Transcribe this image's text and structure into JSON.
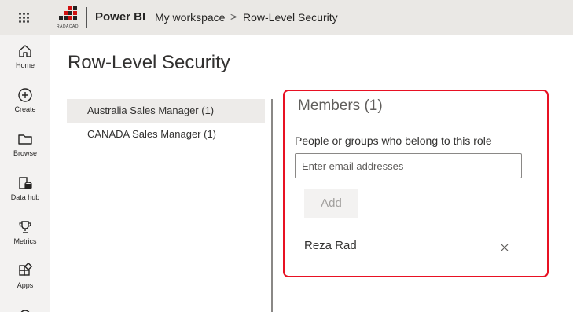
{
  "header": {
    "app_name": "Power BI",
    "breadcrumbs": [
      "My workspace",
      "Row-Level Security"
    ],
    "separator": ">",
    "logo_text": "RADACAD",
    "logo_icon": "radacad-logo"
  },
  "nav": {
    "items": [
      {
        "label": "Home",
        "icon": "home-icon"
      },
      {
        "label": "Create",
        "icon": "plus-circle-icon"
      },
      {
        "label": "Browse",
        "icon": "folder-icon"
      },
      {
        "label": "Data hub",
        "icon": "data-hub-icon"
      },
      {
        "label": "Metrics",
        "icon": "trophy-icon"
      },
      {
        "label": "Apps",
        "icon": "apps-icon"
      }
    ]
  },
  "page": {
    "title": "Row-Level Security"
  },
  "roles": [
    {
      "label": "Australia Sales Manager (1)",
      "selected": true
    },
    {
      "label": "CANADA Sales Manager (1)",
      "selected": false
    }
  ],
  "members": {
    "title": "Members (1)",
    "field_label": "People or groups who belong to this role",
    "input_placeholder": "Enter email addresses",
    "input_value": "",
    "add_label": "Add",
    "list": [
      {
        "name": "Reza Rad",
        "remove": "×"
      }
    ]
  },
  "colors": {
    "highlight": "#e81123",
    "topbar": "#eae8e5",
    "nav_bg": "#f3f2f1"
  }
}
